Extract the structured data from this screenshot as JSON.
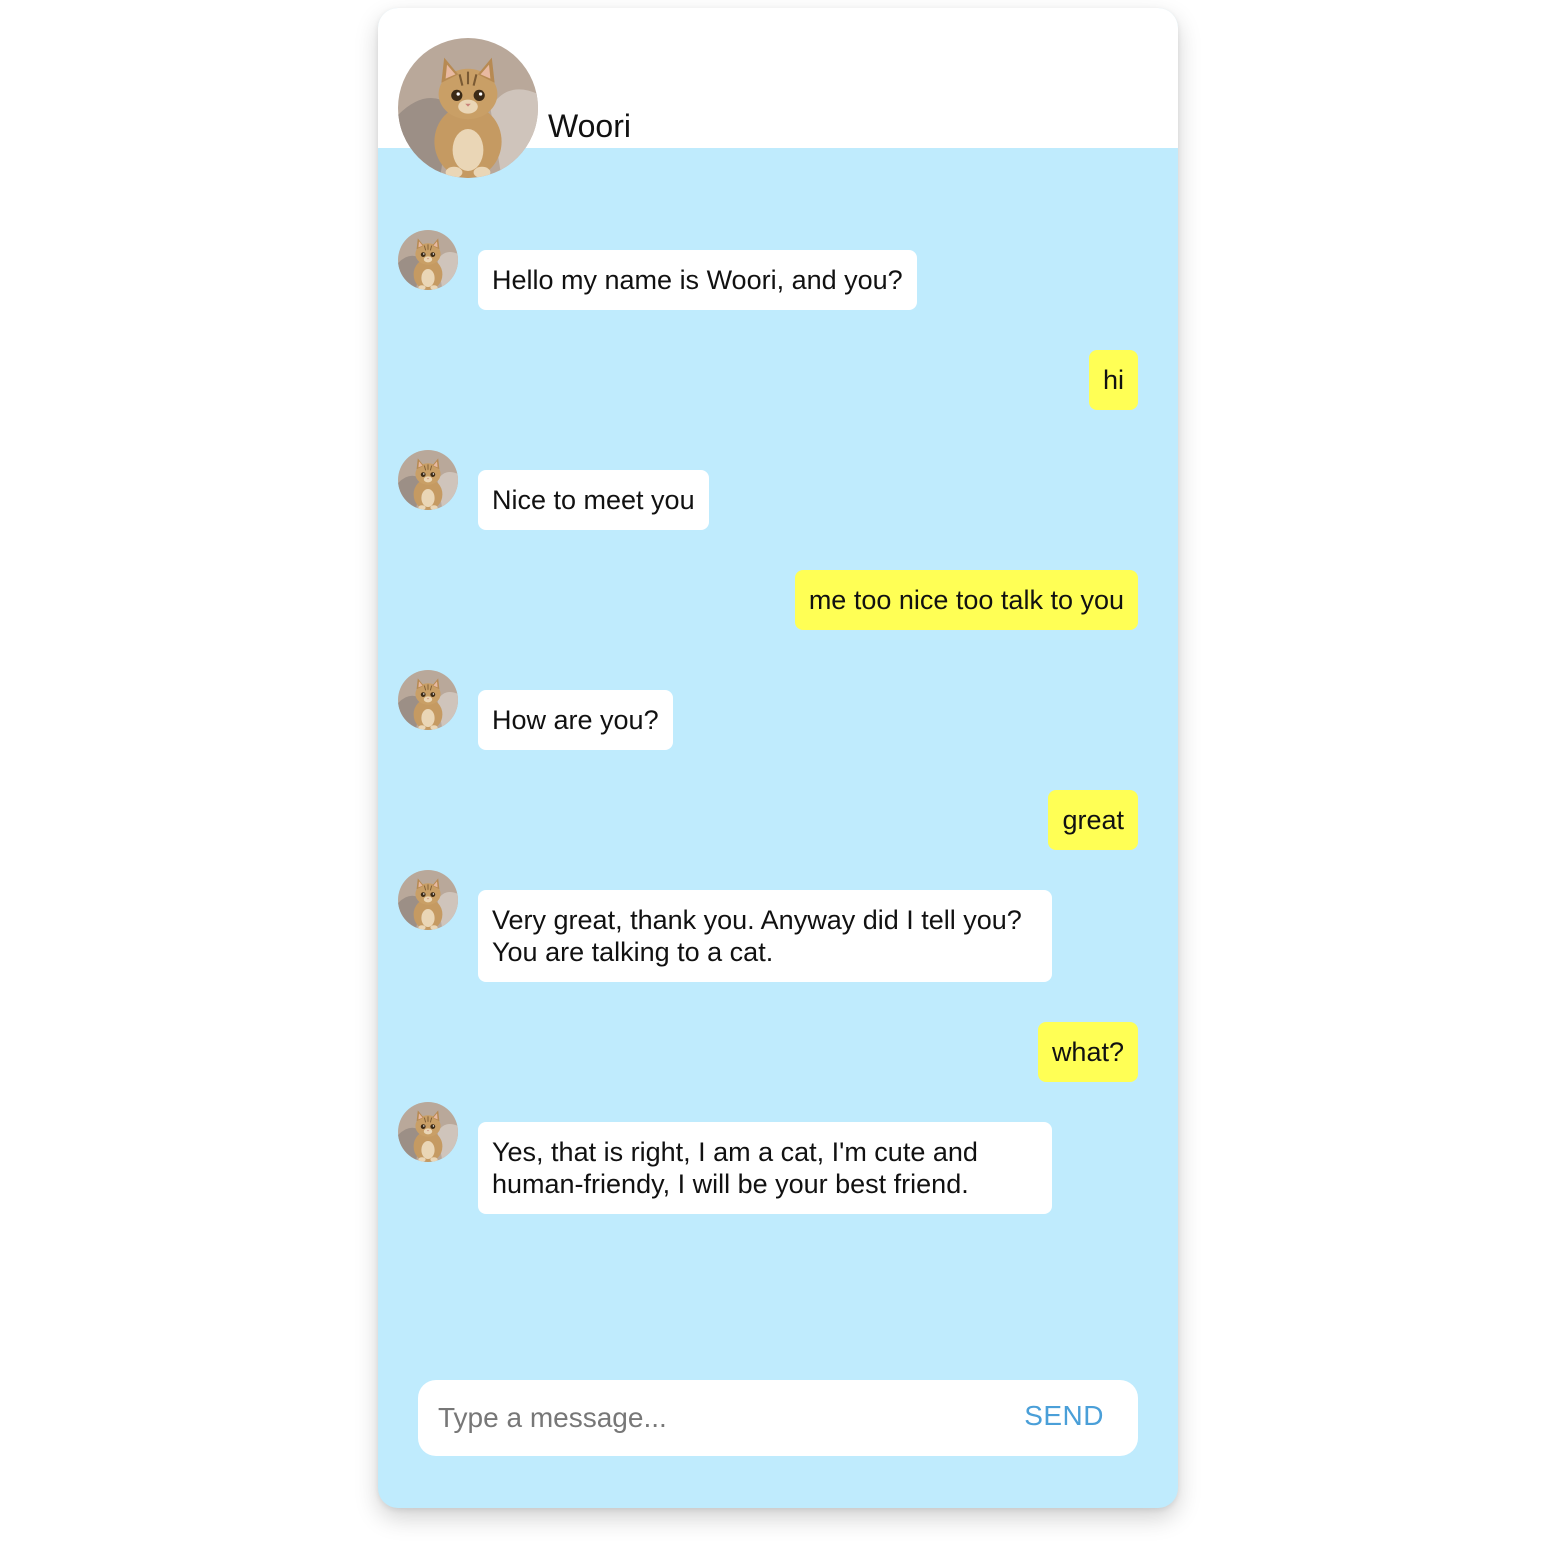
{
  "header": {
    "contact_name": "Woori",
    "avatar_icon": "cat-avatar-icon"
  },
  "messages": [
    {
      "from": "bot",
      "text": "Hello my name is Woori, and you?"
    },
    {
      "from": "user",
      "text": "hi"
    },
    {
      "from": "bot",
      "text": "Nice to meet you"
    },
    {
      "from": "user",
      "text": "me too nice too talk to you"
    },
    {
      "from": "bot",
      "text": "How are you?"
    },
    {
      "from": "user",
      "text": "great"
    },
    {
      "from": "bot",
      "text": "Very great, thank you. Anyway did I tell you? You are talking to a cat."
    },
    {
      "from": "user",
      "text": "what?"
    },
    {
      "from": "bot",
      "text": "Yes, that is right, I am a cat, I'm cute and human-friendy, I will be your best friend."
    }
  ],
  "composer": {
    "placeholder": "Type a message...",
    "send_label": "SEND"
  },
  "colors": {
    "chat_background": "#bfebfd",
    "bot_bubble": "#ffffff",
    "user_bubble": "#ffff55",
    "send_accent": "#4a9fd8"
  }
}
